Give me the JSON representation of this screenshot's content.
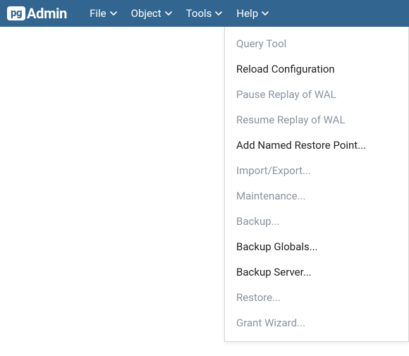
{
  "logo": {
    "badge": "pg",
    "text": "Admin"
  },
  "menubar": {
    "items": [
      {
        "label": "File"
      },
      {
        "label": "Object"
      },
      {
        "label": "Tools"
      },
      {
        "label": "Help"
      }
    ]
  },
  "dropdown": {
    "items": [
      {
        "label": "Query Tool",
        "disabled": true
      },
      {
        "label": "Reload Configuration",
        "disabled": false
      },
      {
        "label": "Pause Replay of WAL",
        "disabled": true
      },
      {
        "label": "Resume Replay of WAL",
        "disabled": true
      },
      {
        "label": "Add Named Restore Point...",
        "disabled": false
      },
      {
        "label": "Import/Export...",
        "disabled": true
      },
      {
        "label": "Maintenance...",
        "disabled": true
      },
      {
        "label": "Backup...",
        "disabled": true
      },
      {
        "label": "Backup Globals...",
        "disabled": false
      },
      {
        "label": "Backup Server...",
        "disabled": false
      },
      {
        "label": "Restore...",
        "disabled": true
      },
      {
        "label": "Grant Wizard...",
        "disabled": true
      }
    ]
  }
}
